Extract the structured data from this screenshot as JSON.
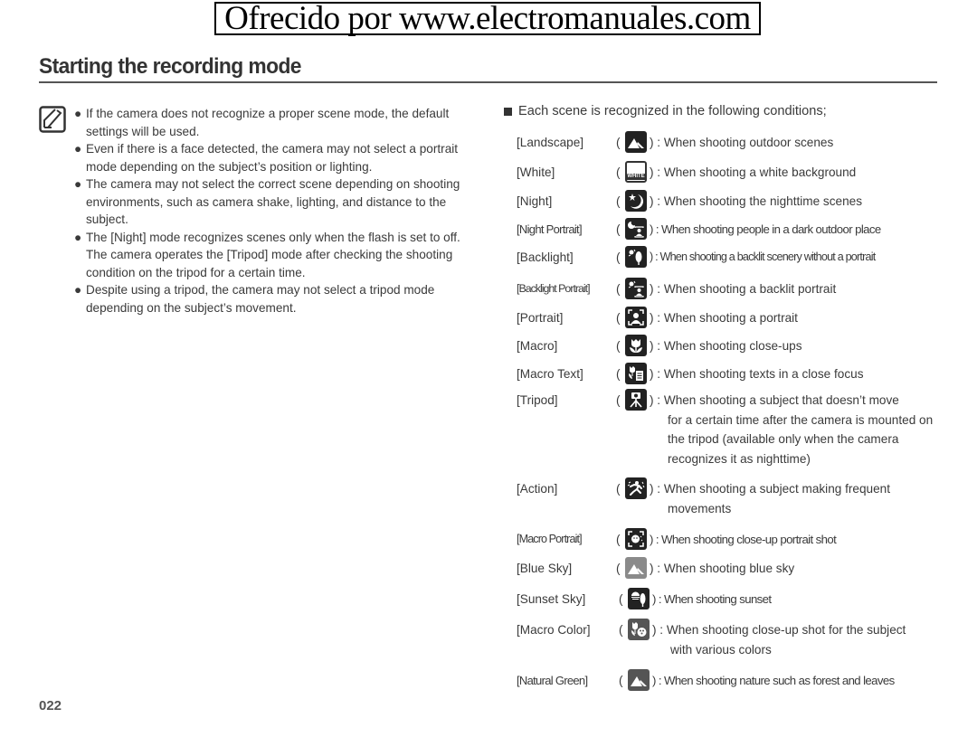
{
  "banner": {
    "text": "Ofrecido por www.electromanuales.com"
  },
  "page": {
    "title": "Starting the recording mode",
    "number": "022"
  },
  "notes": {
    "icon": "note-pencil-icon",
    "items": [
      "If the camera does not recognize a proper scene mode, the default settings will be used.",
      "Even if there is a face detected, the camera may not select a portrait mode depending on the subject’s position or lighting.",
      "The camera may not select the correct scene depending on shooting environments, such as camera shake, lighting, and distance to the subject.",
      "The [Night] mode recognizes scenes only when the flash is set to off. The camera operates the [Tripod] mode after checking the shooting condition on the tripod for a certain time.",
      "Despite using a tripod, the camera may not select a tripod mode depending on the subject’s movement."
    ],
    "bullet": "●"
  },
  "scenes": {
    "intro": "Each scene is recognized in the following conditions;",
    "paren_open": "(",
    "items": [
      {
        "label": "[Landscape]",
        "icon": "landscape-icon",
        "desc": ") : When shooting outdoor scenes",
        "cont": ""
      },
      {
        "label": "[White]",
        "icon": "white-icon",
        "icon_text": "WHITE",
        "desc": ") : When shooting a white background",
        "cont": ""
      },
      {
        "label": "[Night]",
        "icon": "night-icon",
        "desc": ") : When shooting the nighttime scenes",
        "cont": ""
      },
      {
        "label": "[Night Portrait]",
        "icon": "night-portrait-icon",
        "desc": ") : When shooting people in a dark outdoor place",
        "cont": ""
      },
      {
        "label": "[Backlight]",
        "icon": "backlight-icon",
        "desc": ") : When shooting a backlit scenery without a portrait",
        "cont": ""
      },
      {
        "label": "[Backlight Portrait]",
        "icon": "backlight-portrait-icon",
        "desc": ") : When shooting a backlit portrait",
        "cont": ""
      },
      {
        "label": "[Portrait]",
        "icon": "portrait-icon",
        "desc": ") : When shooting a portrait",
        "cont": ""
      },
      {
        "label": "[Macro]",
        "icon": "macro-icon",
        "desc": ") : When shooting close-ups",
        "cont": ""
      },
      {
        "label": "[Macro Text]",
        "icon": "macro-text-icon",
        "desc": ") : When shooting texts in a close focus",
        "cont": ""
      },
      {
        "label": "[Tripod]",
        "icon": "tripod-icon",
        "desc": ") : When shooting a subject that doesn’t move",
        "cont": "for a certain time after the camera is mounted on the tripod (available only when the camera recognizes it as nighttime)"
      },
      {
        "label": "[Action]",
        "icon": "action-icon",
        "desc": ") : When shooting a subject making frequent",
        "cont": "movements"
      },
      {
        "label": "[Macro Portrait]",
        "icon": "macro-portrait-icon",
        "desc": ") : When shooting close-up portrait shot",
        "cont": ""
      },
      {
        "label": "[Blue Sky]",
        "icon": "blue-sky-icon",
        "desc": ") : When shooting blue sky",
        "cont": ""
      },
      {
        "label": "[Sunset Sky]",
        "icon": "sunset-sky-icon",
        "desc": ") : When shooting sunset",
        "cont": ""
      },
      {
        "label": "[Macro Color]",
        "icon": "macro-color-icon",
        "desc": ") : When shooting close-up shot for the subject",
        "cont": "with various colors"
      },
      {
        "label": "[Natural Green]",
        "icon": "natural-green-icon",
        "desc": ") : When shooting nature such as forest and leaves",
        "cont": ""
      }
    ]
  }
}
